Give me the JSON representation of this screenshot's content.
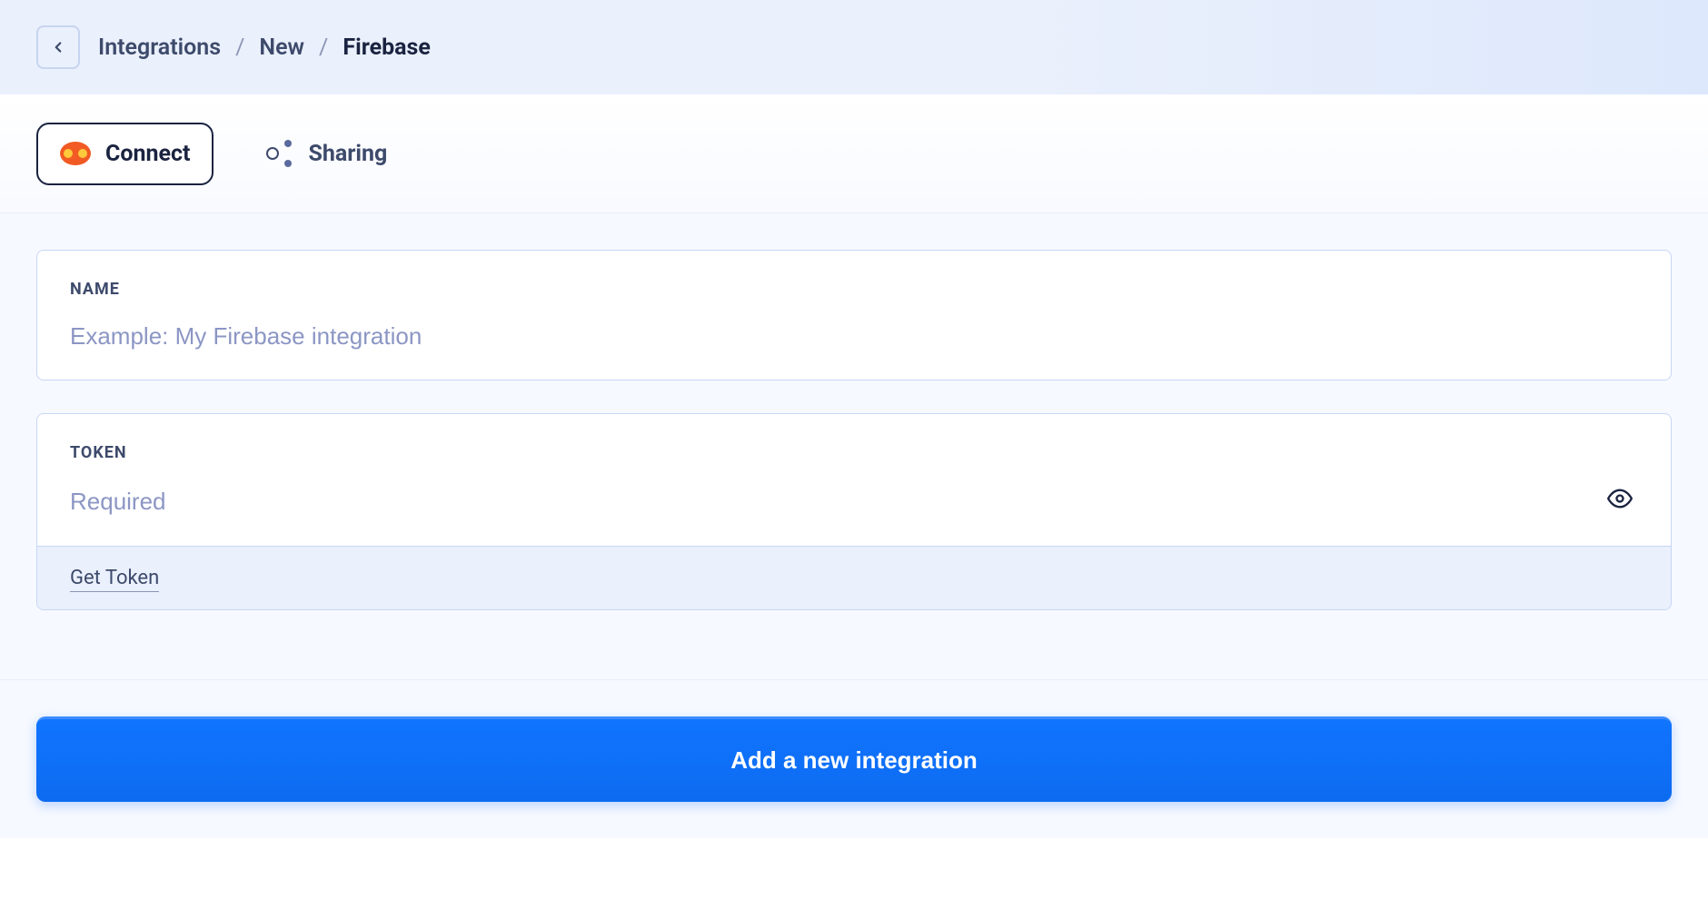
{
  "breadcrumb": {
    "items": [
      {
        "label": "Integrations"
      },
      {
        "label": "New"
      },
      {
        "label": "Firebase"
      }
    ],
    "separator": "/"
  },
  "tabs": {
    "connect": {
      "label": "Connect"
    },
    "sharing": {
      "label": "Sharing"
    }
  },
  "form": {
    "name": {
      "label": "NAME",
      "placeholder": "Example: My Firebase integration",
      "value": ""
    },
    "token": {
      "label": "TOKEN",
      "placeholder": "Required",
      "value": "",
      "helper_link": "Get Token"
    }
  },
  "submit": {
    "label": "Add a new integration"
  },
  "colors": {
    "accent": "#0c61ff",
    "text_primary": "#1a2340",
    "text_secondary": "#3d4a6b",
    "placeholder": "#8c96c4",
    "border": "#c8d6f5",
    "header_bg": "#eaf0fc"
  }
}
